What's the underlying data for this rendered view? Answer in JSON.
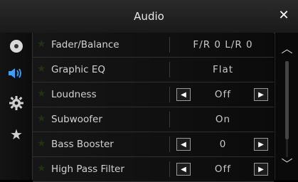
{
  "header": {
    "title": "Audio",
    "close_icon": "close-icon"
  },
  "sidebar": {
    "items": [
      {
        "name": "source-icon"
      },
      {
        "name": "speaker-icon",
        "active": true
      },
      {
        "name": "settings-gear-icon"
      },
      {
        "name": "favorite-star-icon"
      }
    ]
  },
  "rows": [
    {
      "label": "Fader/Balance",
      "value": "F/R 0 L/R 0",
      "arrows": false
    },
    {
      "label": "Graphic EQ",
      "value": "Flat",
      "arrows": false
    },
    {
      "label": "Loudness",
      "value": "Off",
      "arrows": true
    },
    {
      "label": "Subwoofer",
      "value": "On",
      "arrows": false
    },
    {
      "label": "Bass Booster",
      "value": "0",
      "arrows": true
    },
    {
      "label": "High Pass Filter",
      "value": "Off",
      "arrows": true
    }
  ],
  "scroll": {
    "up_icon": "chevron-up-icon",
    "down_icon": "chevron-down-icon"
  },
  "colors": {
    "accent": "#3aa0ff",
    "star_inactive": "#243014"
  }
}
